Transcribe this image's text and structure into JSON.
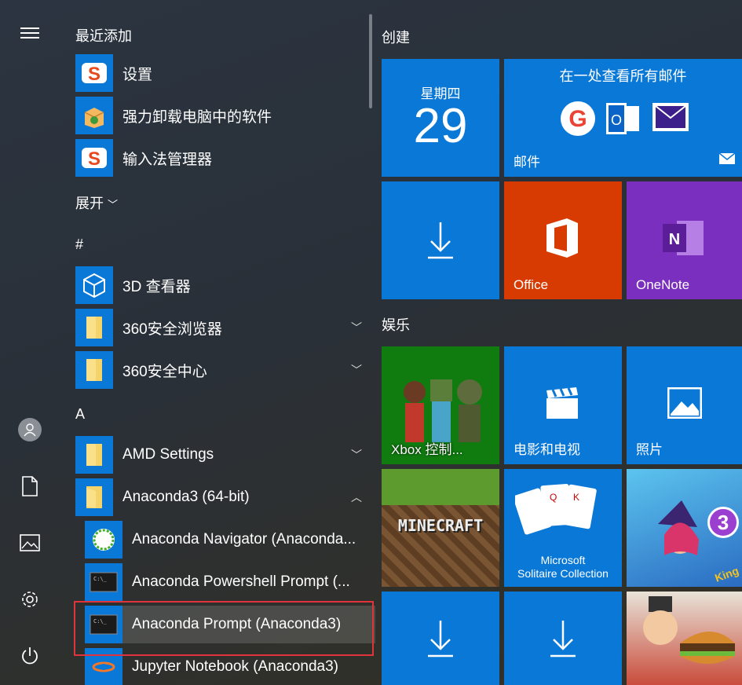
{
  "rail": {
    "menu_icon": "hamburger-icon",
    "user_icon": "user-icon",
    "documents_icon": "document-icon",
    "pictures_icon": "picture-icon",
    "settings_icon": "gear-icon",
    "power_icon": "power-icon"
  },
  "applist": {
    "recent_header": "最近添加",
    "recent": [
      {
        "label": "设置"
      },
      {
        "label": "强力卸载电脑中的软件"
      },
      {
        "label": "输入法管理器"
      }
    ],
    "expand_label": "展开",
    "hash_header": "#",
    "hash_items": [
      {
        "label": "3D 查看器"
      },
      {
        "label": "360安全浏览器"
      },
      {
        "label": "360安全中心"
      }
    ],
    "a_header": "A",
    "a_items": [
      {
        "label": "AMD Settings"
      },
      {
        "label": "Anaconda3 (64-bit)"
      }
    ],
    "anaconda_items": [
      {
        "label": "Anaconda Navigator (Anaconda..."
      },
      {
        "label": "Anaconda Powershell Prompt (..."
      },
      {
        "label": "Anaconda Prompt (Anaconda3)"
      },
      {
        "label": "Jupyter Notebook (Anaconda3)"
      }
    ]
  },
  "tiles": {
    "create_header": "创建",
    "calendar_day": "星期四",
    "calendar_date": "29",
    "mail_top": "在一处查看所有邮件",
    "mail_label": "邮件",
    "office_label": "Office",
    "onenote_label": "OneNote",
    "entertainment_header": "娱乐",
    "xbox_label": "Xbox 控制...",
    "movies_label": "电影和电视",
    "photos_label": "照片",
    "minecraft_text": "MINECRAFT",
    "solitaire_line1": "Microsoft",
    "solitaire_line2": "Solitaire Collection",
    "candy_badge": "3",
    "king_text": "King"
  },
  "colors": {
    "accent": "#0a78d7",
    "office": "#d83b01",
    "onenote": "#7b2fbe",
    "xbox": "#107c10",
    "highlight": "#e0333b"
  }
}
